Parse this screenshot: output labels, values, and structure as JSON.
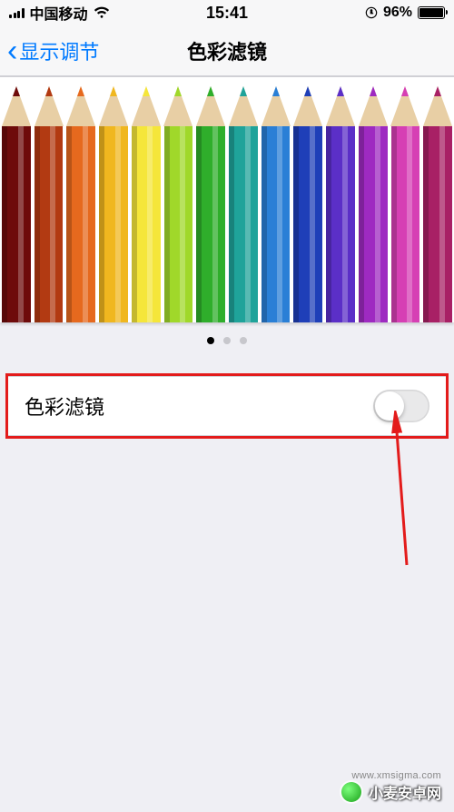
{
  "status_bar": {
    "carrier": "中国移动",
    "time": "15:41",
    "battery_pct": "96%",
    "battery_fill_pct": 96
  },
  "nav": {
    "back_label": "显示调节",
    "title": "色彩滤镜"
  },
  "carousel": {
    "pencil_colors": [
      "#6e0b0b",
      "#b23a12",
      "#e6691e",
      "#f0b71f",
      "#f5e63a",
      "#a0d82a",
      "#2fae2b",
      "#1fa39a",
      "#2a7fd6",
      "#1f3fb8",
      "#5b2fc7",
      "#9e2ac1",
      "#d63fb4",
      "#a82065"
    ],
    "page_count": 3,
    "active_page": 0
  },
  "settings": {
    "color_filter": {
      "label": "色彩滤镜",
      "enabled": false
    }
  },
  "watermark": {
    "site": "小麦安卓网",
    "url": "www.xmsigma.com"
  }
}
